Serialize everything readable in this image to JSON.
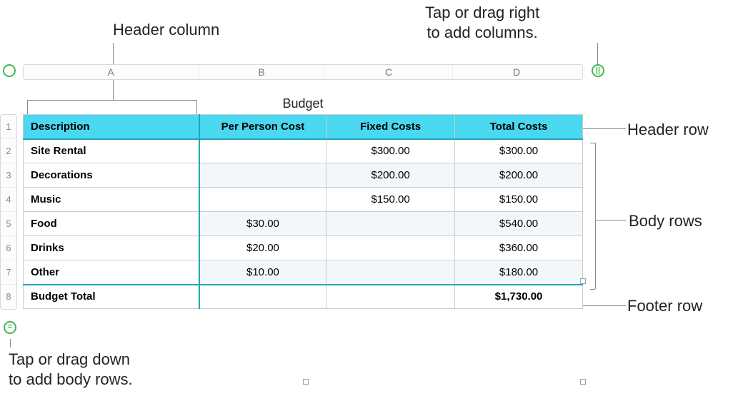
{
  "annotations": {
    "header_column": "Header column",
    "add_columns": "Tap or drag right\nto add columns.",
    "header_row": "Header row",
    "body_rows": "Body rows",
    "footer_row": "Footer row",
    "add_rows": "Tap or drag down\nto add body rows."
  },
  "columns": [
    "A",
    "B",
    "C",
    "D"
  ],
  "row_numbers": [
    "1",
    "2",
    "3",
    "4",
    "5",
    "6",
    "7",
    "8"
  ],
  "table": {
    "title": "Budget",
    "headers": [
      "Description",
      "Per Person Cost",
      "Fixed Costs",
      "Total Costs"
    ],
    "rows": [
      {
        "desc": "Site Rental",
        "ppc": "",
        "fixed": "$300.00",
        "total": "$300.00"
      },
      {
        "desc": "Decorations",
        "ppc": "",
        "fixed": "$200.00",
        "total": "$200.00"
      },
      {
        "desc": "Music",
        "ppc": "",
        "fixed": "$150.00",
        "total": "$150.00"
      },
      {
        "desc": "Food",
        "ppc": "$30.00",
        "fixed": "",
        "total": "$540.00"
      },
      {
        "desc": "Drinks",
        "ppc": "$20.00",
        "fixed": "",
        "total": "$360.00"
      },
      {
        "desc": "Other",
        "ppc": "$10.00",
        "fixed": "",
        "total": "$180.00"
      }
    ],
    "footer": {
      "desc": "Budget Total",
      "ppc": "",
      "fixed": "",
      "total": "$1,730.00"
    }
  },
  "handles": {
    "add_cols_glyph": "||",
    "add_rows_glyph": "="
  },
  "chart_data": {
    "type": "table",
    "title": "Budget",
    "columns": [
      "Description",
      "Per Person Cost",
      "Fixed Costs",
      "Total Costs"
    ],
    "rows": [
      [
        "Site Rental",
        null,
        300.0,
        300.0
      ],
      [
        "Decorations",
        null,
        200.0,
        200.0
      ],
      [
        "Music",
        null,
        150.0,
        150.0
      ],
      [
        "Food",
        30.0,
        null,
        540.0
      ],
      [
        "Drinks",
        20.0,
        null,
        360.0
      ],
      [
        "Other",
        10.0,
        null,
        180.0
      ]
    ],
    "footer": [
      "Budget Total",
      null,
      null,
      1730.0
    ]
  }
}
